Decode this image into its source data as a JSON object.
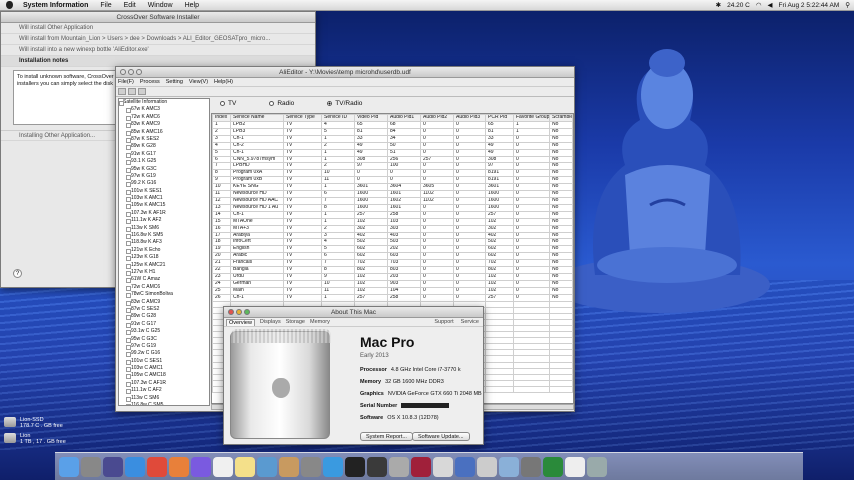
{
  "menubar": {
    "app": "System Information",
    "items": [
      "File",
      "Edit",
      "Window",
      "Help"
    ],
    "status": {
      "temp": "24.20 C",
      "clock": "Fri Aug 2  5:22:44 AM"
    }
  },
  "crossover": {
    "title": "CrossOver Software Installer",
    "rows": [
      "Will install Other Application",
      "Will install from Mountain_Lion > Users > dee > Downloads > ALI_Editor_GEOSATpro_micro...",
      "Will install into a new winexp bottle 'AliEditor.exe'",
      "Installation notes"
    ],
    "notes": "To install unknown software, CrossOver r installers you can simply select the disk",
    "installing": "Installing Other Application...",
    "help": "?"
  },
  "alieditor": {
    "title": "AliEditor - Y:\\Movies\\temp microhd\\userdb.udf",
    "menus": [
      "File(F)",
      "Process",
      "Setting",
      "View(V)",
      "Help(H)"
    ],
    "tree_root": "Satellite Information",
    "tree_items": [
      "67w K AMC3",
      "72w K AMC6",
      "83w K AMC9",
      "85w K AMC16",
      "87w K SES2",
      "89w K G28",
      "91w K G17",
      "93.1 K G25",
      "95w K G3C",
      "97w K G19",
      "99.2 K G16",
      "101w K SES1",
      "103w K AMC1",
      "105w K AMC15",
      "107.3w K AF1R",
      "111.1w K AF2",
      "113w K SM6",
      "116.8w K SM5",
      "118.8w K AF3",
      "121w K Echo",
      "123w K G18",
      "125w K AMC21",
      "127w K H1",
      "61W C Amaz",
      "72w C AMC6",
      "78wC SimonBoliva",
      "83w C AMC9",
      "87w C SES2",
      "89w C G28",
      "91w C G17",
      "93.1w C G25",
      "95w C G3C",
      "97w C G19",
      "99.2w C G16",
      "101w C SES1",
      "103w C AMC1",
      "105w C AMC18",
      "107.3w C AF1R",
      "111.1w C AF2",
      "113w C SM6",
      "116.8w C SM5",
      "118.8w C AF3"
    ],
    "radios": [
      "TV",
      "Radio",
      "TV/Radio"
    ],
    "columns": [
      "Index",
      "Service Name",
      "Service Type",
      "Service ID",
      "Video Pid",
      "Audio Pid1",
      "Audio Pid2",
      "Audio Pid3",
      "PCR Pid",
      "Favorite Group",
      "Scramble",
      "I"
    ],
    "rows": [
      [
        "1",
        "LPB2",
        "TV",
        "4",
        "65",
        "68",
        "0",
        "0",
        "65",
        "1",
        "No",
        "N"
      ],
      [
        "2",
        "LPB3",
        "TV",
        "5",
        "81",
        "84",
        "0",
        "0",
        "81",
        "1",
        "No",
        "N"
      ],
      [
        "3",
        "Ch-1",
        "TV",
        "1",
        "33",
        "34",
        "0",
        "0",
        "33",
        "0",
        "No",
        "N"
      ],
      [
        "4",
        "Ch-2",
        "TV",
        "2",
        "49",
        "50",
        "0",
        "0",
        "49",
        "0",
        "No",
        "N"
      ],
      [
        "5",
        "Ch-1",
        "TV",
        "1",
        "49",
        "51",
        "0",
        "0",
        "49",
        "0",
        "No",
        "N"
      ],
      [
        "6",
        "CNN_5.9787msym",
        "TV",
        "1",
        "308",
        "256",
        "257",
        "0",
        "308",
        "0",
        "No",
        "N"
      ],
      [
        "7",
        "LPBHD",
        "TV",
        "2",
        "97",
        "100",
        "0",
        "0",
        "97",
        "0",
        "No",
        "N"
      ],
      [
        "8",
        "Program 0xA",
        "TV",
        "10",
        "0",
        "0",
        "0",
        "0",
        "8191",
        "0",
        "No",
        "N"
      ],
      [
        "9",
        "Program 0xB",
        "TV",
        "11",
        "0",
        "0",
        "0",
        "0",
        "8191",
        "0",
        "No",
        "N"
      ],
      [
        "10",
        "KEYE SNG",
        "TV",
        "1",
        "3601",
        "3604",
        "3605",
        "0",
        "3601",
        "0",
        "No",
        "N"
      ],
      [
        "11",
        "Newsource HD",
        "TV",
        "6",
        "1600",
        "1601",
        "1102",
        "0",
        "1600",
        "0",
        "No",
        "N"
      ],
      [
        "12",
        "Newsource HD AAC",
        "TV",
        "7",
        "1600",
        "1602",
        "1102",
        "0",
        "1600",
        "0",
        "No",
        "N"
      ],
      [
        "13",
        "Newsource HD 1 Au",
        "TV",
        "8",
        "1600",
        "1601",
        "0",
        "0",
        "1600",
        "0",
        "No",
        "N"
      ],
      [
        "14",
        "Ch-1",
        "TV",
        "1",
        "257",
        "258",
        "0",
        "0",
        "257",
        "0",
        "No",
        "N"
      ],
      [
        "15",
        "MTAOne",
        "TV",
        "1",
        "102",
        "103",
        "0",
        "0",
        "102",
        "0",
        "No",
        "N"
      ],
      [
        "16",
        "MTA+3",
        "TV",
        "2",
        "302",
        "303",
        "0",
        "0",
        "302",
        "0",
        "No",
        "N"
      ],
      [
        "17",
        "Arabiya",
        "TV",
        "3",
        "402",
        "403",
        "0",
        "0",
        "402",
        "0",
        "No",
        "N"
      ],
      [
        "18",
        "InfoCert",
        "TV",
        "4",
        "502",
        "503",
        "0",
        "0",
        "502",
        "0",
        "No",
        "N"
      ],
      [
        "19",
        "English",
        "TV",
        "5",
        "602",
        "202",
        "0",
        "0",
        "602",
        "0",
        "No",
        "N"
      ],
      [
        "20",
        "Arabic",
        "TV",
        "6",
        "602",
        "603",
        "0",
        "0",
        "602",
        "0",
        "No",
        "N"
      ],
      [
        "21",
        "Francais",
        "TV",
        "7",
        "702",
        "703",
        "0",
        "0",
        "702",
        "0",
        "No",
        "N"
      ],
      [
        "22",
        "Bangla",
        "TV",
        "8",
        "802",
        "803",
        "0",
        "0",
        "802",
        "0",
        "No",
        "N"
      ],
      [
        "23",
        "Urdu",
        "TV",
        "9",
        "102",
        "203",
        "0",
        "0",
        "102",
        "0",
        "No",
        "N"
      ],
      [
        "24",
        "German",
        "TV",
        "10",
        "102",
        "903",
        "0",
        "0",
        "102",
        "0",
        "No",
        "N"
      ],
      [
        "25",
        "Main",
        "TV",
        "11",
        "102",
        "104",
        "0",
        "0",
        "102",
        "0",
        "No",
        "N"
      ],
      [
        "26",
        "Ch-1",
        "TV",
        "1",
        "257",
        "258",
        "0",
        "0",
        "257",
        "0",
        "No",
        "N"
      ]
    ]
  },
  "about": {
    "title": "About This Mac",
    "tabs": [
      "Overview",
      "Displays",
      "Storage",
      "Memory"
    ],
    "links": [
      "Support",
      "Service"
    ],
    "model": "Mac Pro",
    "year": "Early 2013",
    "specs": [
      {
        "k": "Processor",
        "v": "4.8 GHz Intel Core i7-3770 k"
      },
      {
        "k": "Memory",
        "v": "32 GB 1600 MHz DDR3"
      },
      {
        "k": "Graphics",
        "v": "NVIDIA GeForce GTX 660 Ti 2048 MB"
      },
      {
        "k": "Serial Number",
        "v": ""
      },
      {
        "k": "Software",
        "v": "OS X 10.8.3 (12D78)"
      }
    ],
    "buttons": [
      "System Report...",
      "Software Update..."
    ]
  },
  "disks": [
    {
      "name": "Lion-SSD",
      "info": "178.7 C . GB free"
    },
    {
      "name": "Lion",
      "info": "1 TB , 17 . GB free"
    }
  ],
  "dock": [
    "finder",
    "launchpad",
    "mission-control",
    "safari",
    "chrome",
    "firefox",
    "itunes",
    "calendar",
    "notes",
    "mail",
    "contacts",
    "preferences",
    "app-store",
    "terminal",
    "activity",
    "system-info",
    "wine",
    "photo",
    "bottle",
    "scissors",
    "preview",
    "font",
    "sheet",
    "editor",
    "trash"
  ]
}
